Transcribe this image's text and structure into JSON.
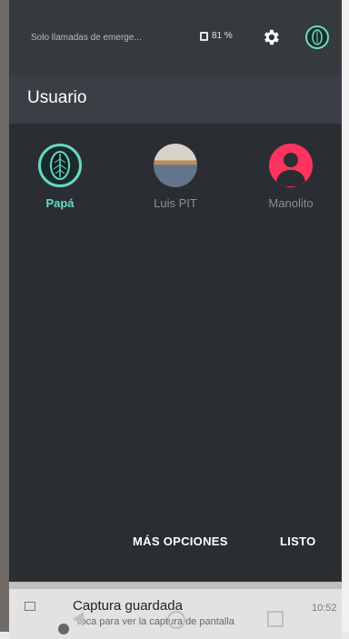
{
  "status_bar": {
    "notification_text": "Solo llamadas de emerge...",
    "battery_percent": "81 %"
  },
  "header": {
    "title": "Usuario"
  },
  "users": [
    {
      "name": "Papá",
      "active": true
    },
    {
      "name": "Luis PIT",
      "active": false
    },
    {
      "name": "Manolito",
      "active": false
    }
  ],
  "actions": {
    "more_options": "MÁS OPCIONES",
    "done": "LISTO"
  },
  "notification": {
    "title": "Captura guardada",
    "subtitle": "Toca para ver la captura de pantalla",
    "time": "10:52"
  }
}
